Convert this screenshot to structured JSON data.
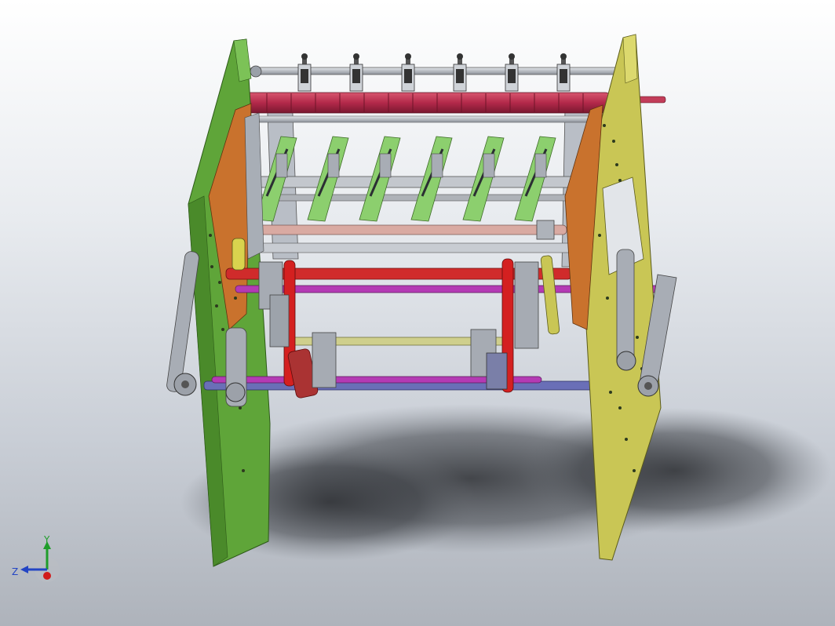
{
  "viewport": {
    "background_top": "#ffffff",
    "background_bottom": "#aeb3bb"
  },
  "model": {
    "left_side_plate_color": "#5fa539",
    "right_side_plate_color": "#c9c655",
    "inner_bracket_color": "#c9722d",
    "tension_arm_color": "#8ccf6e",
    "rubber_roller_color": "#b8304f",
    "red_link_color": "#d42020",
    "magenta_shaft_color": "#b43ab4",
    "pink_shaft_color": "#d7a79f",
    "khaki_shaft_color": "#cfcf8c",
    "blue_shaft_color": "#6a6fb7",
    "grey_part_color": "#a6abb3",
    "tension_arm_count": 6,
    "blade_holder_count": 6
  },
  "triad": {
    "icon": "coordinate-triad-icon",
    "y_label": "Y",
    "z_label": "Z",
    "y_color": "#1f9d2a",
    "z_color": "#2345c4",
    "x_color": "#d11b1b"
  }
}
